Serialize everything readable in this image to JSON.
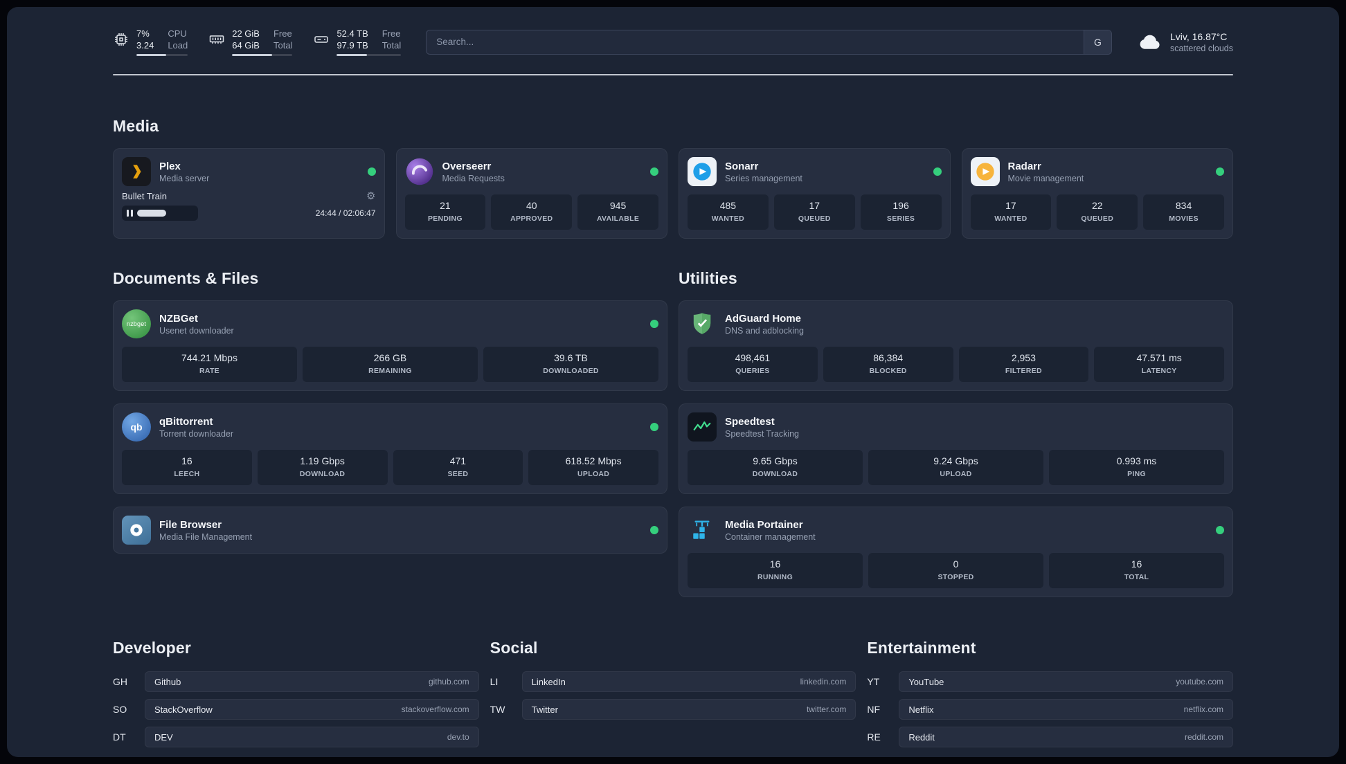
{
  "colors": {
    "status_online": "#35cf7d",
    "panel_bg": "#1c2434",
    "card_bg": "#262e40"
  },
  "topbar": {
    "cpu": {
      "percent": "7%",
      "load": "3.24",
      "label_top": "CPU",
      "label_bottom": "Load"
    },
    "memory": {
      "free": "22 GiB",
      "total": "64 GiB",
      "label_top": "Free",
      "label_bottom": "Total"
    },
    "disk": {
      "free": "52.4 TB",
      "total": "97.9 TB",
      "label_top": "Free",
      "label_bottom": "Total"
    },
    "search": {
      "placeholder": "Search...",
      "bang": "G"
    },
    "weather": {
      "location": "Lviv, 16.87°C",
      "condition": "scattered clouds"
    }
  },
  "icons": {
    "nzbget_text": "nzbget",
    "qbittorrent_text": "qb"
  },
  "sections": {
    "media": {
      "heading": "Media",
      "cards": {
        "plex": {
          "title": "Plex",
          "subtitle": "Media server",
          "now_playing": "Bullet Train",
          "time": "24:44 / 02:06:47"
        },
        "overseerr": {
          "title": "Overseerr",
          "subtitle": "Media Requests",
          "stats": [
            {
              "value": "21",
              "label": "PENDING"
            },
            {
              "value": "40",
              "label": "APPROVED"
            },
            {
              "value": "945",
              "label": "AVAILABLE"
            }
          ]
        },
        "sonarr": {
          "title": "Sonarr",
          "subtitle": "Series management",
          "stats": [
            {
              "value": "485",
              "label": "WANTED"
            },
            {
              "value": "17",
              "label": "QUEUED"
            },
            {
              "value": "196",
              "label": "SERIES"
            }
          ]
        },
        "radarr": {
          "title": "Radarr",
          "subtitle": "Movie management",
          "stats": [
            {
              "value": "17",
              "label": "WANTED"
            },
            {
              "value": "22",
              "label": "QUEUED"
            },
            {
              "value": "834",
              "label": "MOVIES"
            }
          ]
        }
      }
    },
    "documents": {
      "heading": "Documents & Files",
      "cards": {
        "nzbget": {
          "title": "NZBGet",
          "subtitle": "Usenet downloader",
          "stats": [
            {
              "value": "744.21 Mbps",
              "label": "RATE"
            },
            {
              "value": "266 GB",
              "label": "REMAINING"
            },
            {
              "value": "39.6 TB",
              "label": "DOWNLOADED"
            }
          ]
        },
        "qbittorrent": {
          "title": "qBittorrent",
          "subtitle": "Torrent downloader",
          "stats": [
            {
              "value": "16",
              "label": "LEECH"
            },
            {
              "value": "1.19 Gbps",
              "label": "DOWNLOAD"
            },
            {
              "value": "471",
              "label": "SEED"
            },
            {
              "value": "618.52 Mbps",
              "label": "UPLOAD"
            }
          ]
        },
        "filebrowser": {
          "title": "File Browser",
          "subtitle": "Media File Management"
        }
      }
    },
    "utilities": {
      "heading": "Utilities",
      "cards": {
        "adguard": {
          "title": "AdGuard Home",
          "subtitle": "DNS and adblocking",
          "stats": [
            {
              "value": "498,461",
              "label": "QUERIES"
            },
            {
              "value": "86,384",
              "label": "BLOCKED"
            },
            {
              "value": "2,953",
              "label": "FILTERED"
            },
            {
              "value": "47.571 ms",
              "label": "LATENCY"
            }
          ]
        },
        "speedtest": {
          "title": "Speedtest",
          "subtitle": "Speedtest Tracking",
          "stats": [
            {
              "value": "9.65 Gbps",
              "label": "DOWNLOAD"
            },
            {
              "value": "9.24 Gbps",
              "label": "UPLOAD"
            },
            {
              "value": "0.993 ms",
              "label": "PING"
            }
          ]
        },
        "portainer": {
          "title": "Media Portainer",
          "subtitle": "Container management",
          "stats": [
            {
              "value": "16",
              "label": "RUNNING"
            },
            {
              "value": "0",
              "label": "STOPPED"
            },
            {
              "value": "16",
              "label": "TOTAL"
            }
          ]
        }
      }
    }
  },
  "bookmarks": {
    "developer": {
      "heading": "Developer",
      "items": [
        {
          "abbr": "GH",
          "name": "Github",
          "domain": "github.com"
        },
        {
          "abbr": "SO",
          "name": "StackOverflow",
          "domain": "stackoverflow.com"
        },
        {
          "abbr": "DT",
          "name": "DEV",
          "domain": "dev.to"
        }
      ]
    },
    "social": {
      "heading": "Social",
      "items": [
        {
          "abbr": "LI",
          "name": "LinkedIn",
          "domain": "linkedin.com"
        },
        {
          "abbr": "TW",
          "name": "Twitter",
          "domain": "twitter.com"
        }
      ]
    },
    "entertainment": {
      "heading": "Entertainment",
      "items": [
        {
          "abbr": "YT",
          "name": "YouTube",
          "domain": "youtube.com"
        },
        {
          "abbr": "NF",
          "name": "Netflix",
          "domain": "netflix.com"
        },
        {
          "abbr": "RE",
          "name": "Reddit",
          "domain": "reddit.com"
        }
      ]
    }
  }
}
